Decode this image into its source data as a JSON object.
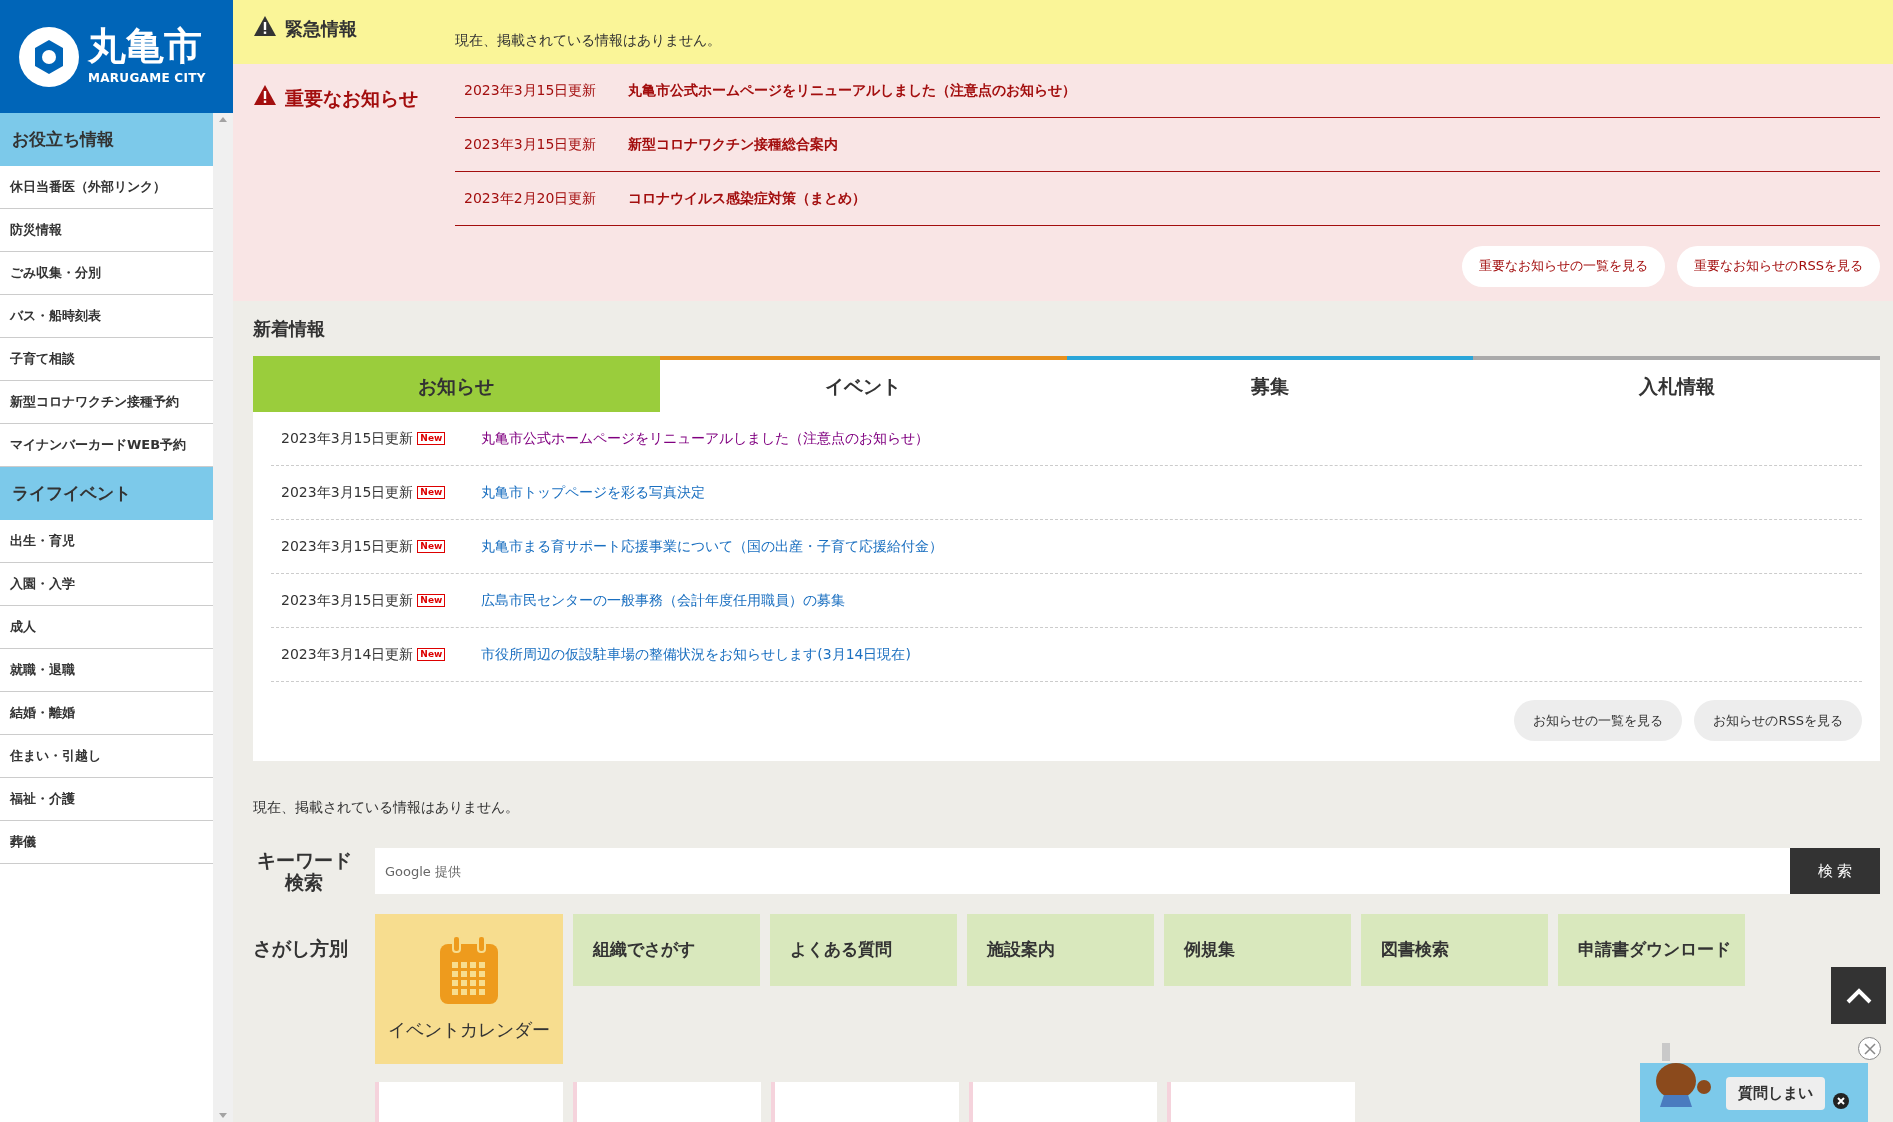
{
  "logo": {
    "name": "丸亀市",
    "subtitle": "MARUGAME CITY"
  },
  "sidebar": {
    "sections": [
      {
        "title": "お役立ち情報",
        "items": [
          "休日当番医（外部リンク）",
          "防災情報",
          "ごみ収集・分別",
          "バス・船時刻表",
          "子育て相談",
          "新型コロナワクチン接種予約",
          "マイナンバーカードWEB予約"
        ]
      },
      {
        "title": "ライフイベント",
        "items": [
          "出生・育児",
          "入園・入学",
          "成人",
          "就職・退職",
          "結婚・離婚",
          "住まい・引越し",
          "福祉・介護",
          "葬儀"
        ]
      }
    ]
  },
  "emergency": {
    "title": "緊急情報",
    "message": "現在、掲載されている情報はありません。"
  },
  "important": {
    "title": "重要なお知らせ",
    "items": [
      {
        "date": "2023年3月15日更新",
        "title": "丸亀市公式ホームページをリニューアルしました（注意点のお知らせ）"
      },
      {
        "date": "2023年3月15日更新",
        "title": "新型コロナワクチン接種総合案内"
      },
      {
        "date": "2023年2月20日更新",
        "title": "コロナウイルス感染症対策（まとめ）"
      }
    ],
    "buttons": [
      "重要なお知らせの一覧を見る",
      "重要なお知らせのRSSを見る"
    ]
  },
  "news": {
    "title": "新着情報",
    "tabs": [
      {
        "label": "お知らせ",
        "selected": true,
        "color": "#9acd3c"
      },
      {
        "label": "イベント",
        "selected": false,
        "color": "#e8901c"
      },
      {
        "label": "募集",
        "selected": false,
        "color": "#2aa6d9"
      },
      {
        "label": "入札情報",
        "selected": false,
        "color": "#aaaaaa"
      }
    ],
    "items": [
      {
        "date": "2023年3月15日更新",
        "badge": "New",
        "title": "丸亀市公式ホームページをリニューアルしました（注意点のお知らせ）",
        "visited": true
      },
      {
        "date": "2023年3月15日更新",
        "badge": "New",
        "title": "丸亀市トップページを彩る写真決定",
        "visited": false
      },
      {
        "date": "2023年3月15日更新",
        "badge": "New",
        "title": "丸亀市まる育サポート応援事業について（国の出産・子育て応援給付金）",
        "visited": false
      },
      {
        "date": "2023年3月15日更新",
        "badge": "New",
        "title": "広島市民センターの一般事務（会計年度任用職員）の募集",
        "visited": false
      },
      {
        "date": "2023年3月14日更新",
        "badge": "New",
        "title": "市役所周辺の仮設駐車場の整備状況をお知らせします(3月14日現在)",
        "visited": false
      }
    ],
    "buttons": [
      "お知らせの一覧を見る",
      "お知らせのRSSを見る"
    ]
  },
  "notice": "現在、掲載されている情報はありません。",
  "search": {
    "label": "キーワード検索",
    "placeholder": "Google 提供",
    "button": "検 索"
  },
  "browse": {
    "label": "さがし方別",
    "items": [
      {
        "kind": "calendar",
        "label": "イベントカレンダー"
      },
      {
        "kind": "plain",
        "label": "組織でさがす"
      },
      {
        "kind": "plain",
        "label": "よくある質問"
      },
      {
        "kind": "plain",
        "label": "施設案内"
      },
      {
        "kind": "plain",
        "label": "例規集"
      },
      {
        "kind": "plain",
        "label": "図書検索"
      },
      {
        "kind": "plain",
        "label": "申請書ダウンロード"
      }
    ]
  },
  "chat": {
    "bubble": "質問しまい"
  }
}
